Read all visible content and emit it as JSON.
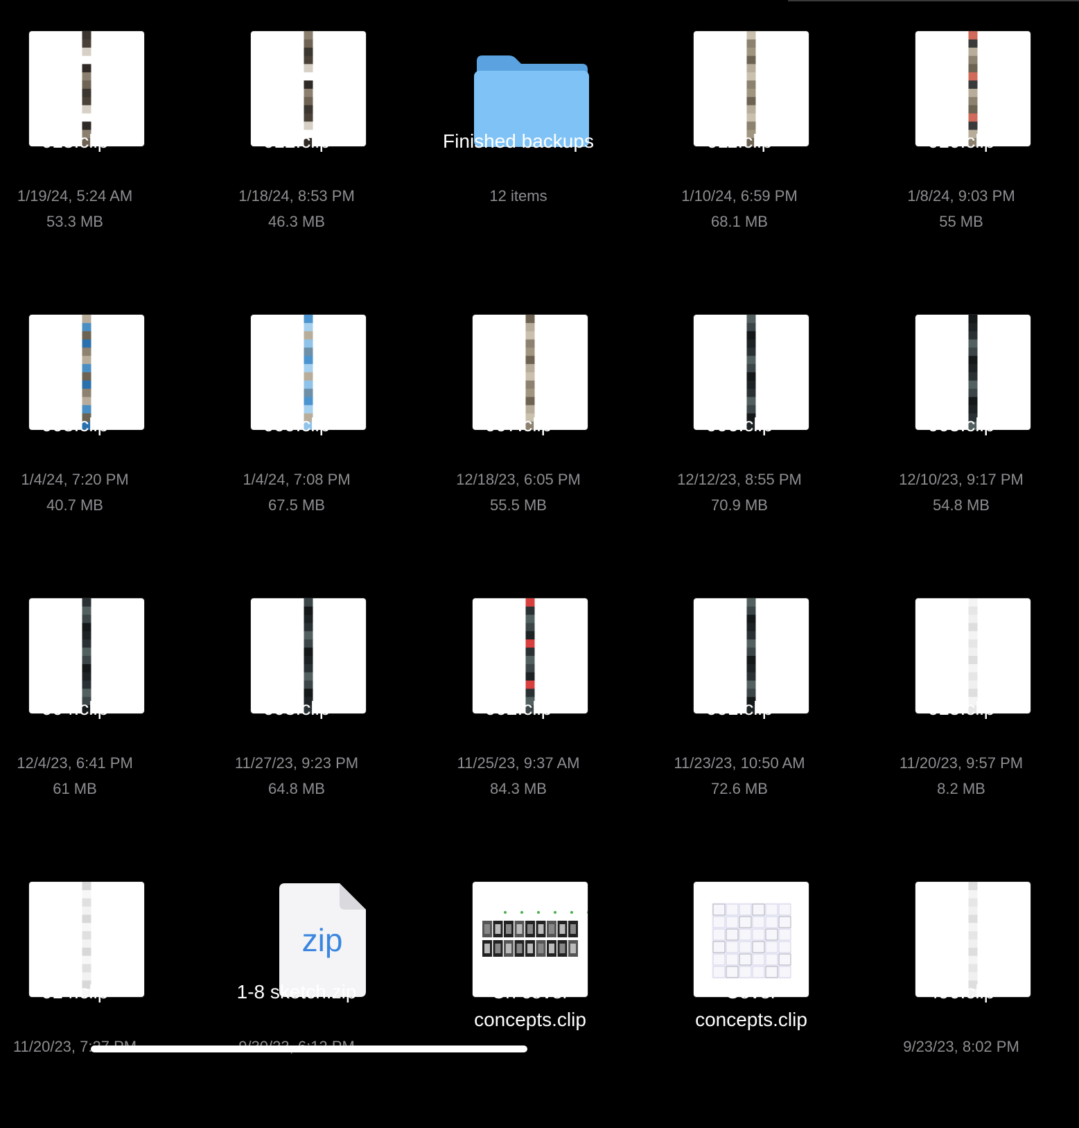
{
  "items": [
    {
      "name": "013.clip",
      "date": "1/19/24, 5:24 AM",
      "size": "53.3 MB",
      "kind": "clip",
      "strip": "mixed"
    },
    {
      "name": "012.clip",
      "date": "1/18/24, 8:53 PM",
      "size": "46.3 MB",
      "kind": "clip",
      "strip": "mixed"
    },
    {
      "name": "Finished backups",
      "date": "12 items",
      "size": "",
      "kind": "folder"
    },
    {
      "name": "011.clip",
      "date": "1/10/24, 6:59 PM",
      "size": "68.1 MB",
      "kind": "clip",
      "strip": "beige"
    },
    {
      "name": "010.clip",
      "date": "1/8/24, 9:03 PM",
      "size": "55 MB",
      "kind": "clip",
      "strip": "beige-red"
    },
    {
      "name": "008.clip",
      "date": "1/4/24, 7:20 PM",
      "size": "40.7 MB",
      "kind": "clip",
      "strip": "beige-blue"
    },
    {
      "name": "009.clip",
      "date": "1/4/24, 7:08 PM",
      "size": "67.5 MB",
      "kind": "clip",
      "strip": "blue"
    },
    {
      "name": "007.clip",
      "date": "12/18/23, 6:05 PM",
      "size": "55.5 MB",
      "kind": "clip",
      "strip": "beige"
    },
    {
      "name": "006.clip",
      "date": "12/12/23, 8:55 PM",
      "size": "70.9 MB",
      "kind": "clip",
      "strip": "dark"
    },
    {
      "name": "005.clip",
      "date": "12/10/23, 9:17 PM",
      "size": "54.8 MB",
      "kind": "clip",
      "strip": "dark"
    },
    {
      "name": "004.clip",
      "date": "12/4/23, 6:41 PM",
      "size": "61 MB",
      "kind": "clip",
      "strip": "dark"
    },
    {
      "name": "003.clip",
      "date": "11/27/23, 9:23 PM",
      "size": "64.8 MB",
      "kind": "clip",
      "strip": "dark"
    },
    {
      "name": "002.clip",
      "date": "11/25/23, 9:37 AM",
      "size": "84.3 MB",
      "kind": "clip",
      "strip": "dark-red"
    },
    {
      "name": "001.clip",
      "date": "11/23/23, 10:50 AM",
      "size": "72.6 MB",
      "kind": "clip",
      "strip": "dark"
    },
    {
      "name": "015.clip",
      "date": "11/20/23, 9:57 PM",
      "size": "8.2 MB",
      "kind": "clip",
      "strip": "light"
    },
    {
      "name": "014.clip",
      "date": "11/20/23, 7:27 PM",
      "size": "",
      "kind": "clip",
      "strip": "sketch"
    },
    {
      "name": "1-8 sketch.zip",
      "date": "9/30/23, 6:12 PM",
      "size": "",
      "kind": "zip",
      "zip_label": "zip"
    },
    {
      "name": "Ch cover concepts.clip",
      "date": "",
      "size": "",
      "kind": "cover"
    },
    {
      "name": "Cover concepts.clip",
      "date": "",
      "size": "",
      "kind": "sheet"
    },
    {
      "name": "490.clip",
      "date": "9/23/23, 8:02 PM",
      "size": "",
      "kind": "clip",
      "strip": "light"
    }
  ],
  "colors": {
    "background": "#000000",
    "title": "#ffffff",
    "meta": "#8e8e93",
    "folder_front": "#7fc2f5",
    "folder_back": "#5aa2e0",
    "zip_text": "#3a86e0"
  },
  "icons": {
    "folder": "folder-icon",
    "zip": "zip-document-icon"
  }
}
